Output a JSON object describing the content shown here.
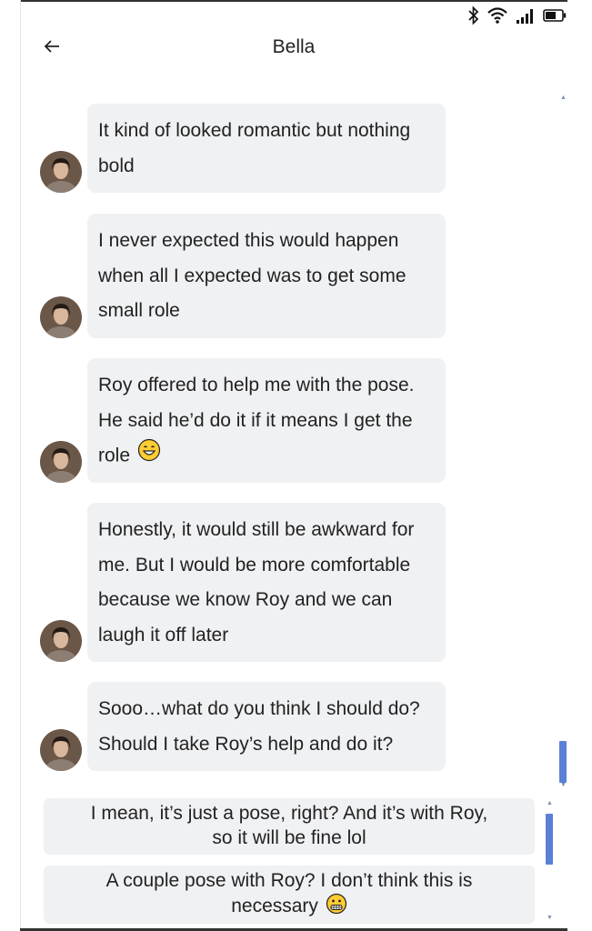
{
  "status_bar": {
    "icons": [
      "bluetooth-icon",
      "wifi-icon",
      "signal-icon",
      "battery-icon"
    ]
  },
  "header": {
    "title": "Bella",
    "back_icon": "arrow-left-icon"
  },
  "messages": [
    {
      "text": "It kind of looked romantic but nothing bold"
    },
    {
      "text": "I never expected this would happen when all I expected was to get some small role"
    },
    {
      "text": "Roy offered to help me with the pose. He said he’d do it if it means I get the role",
      "emoji": "grinning-face-icon"
    },
    {
      "text": "Honestly, it would still be awkward for me. But I would be more comfortable because we know Roy and we can laugh it off later"
    },
    {
      "text": "Sooo…what do you think I should do? Should I take Roy’s help and do it?"
    }
  ],
  "reply_options": [
    {
      "text": "I mean, it’s just a pose, right? And it’s with Roy, so it will be fine lol"
    },
    {
      "text": "A couple pose with Roy? I don’t think this is necessary",
      "emoji": "grimacing-face-icon"
    }
  ],
  "colors": {
    "bubble": "#f0f1f3",
    "scrollbar": "#5b80d6",
    "text": "#222222"
  }
}
